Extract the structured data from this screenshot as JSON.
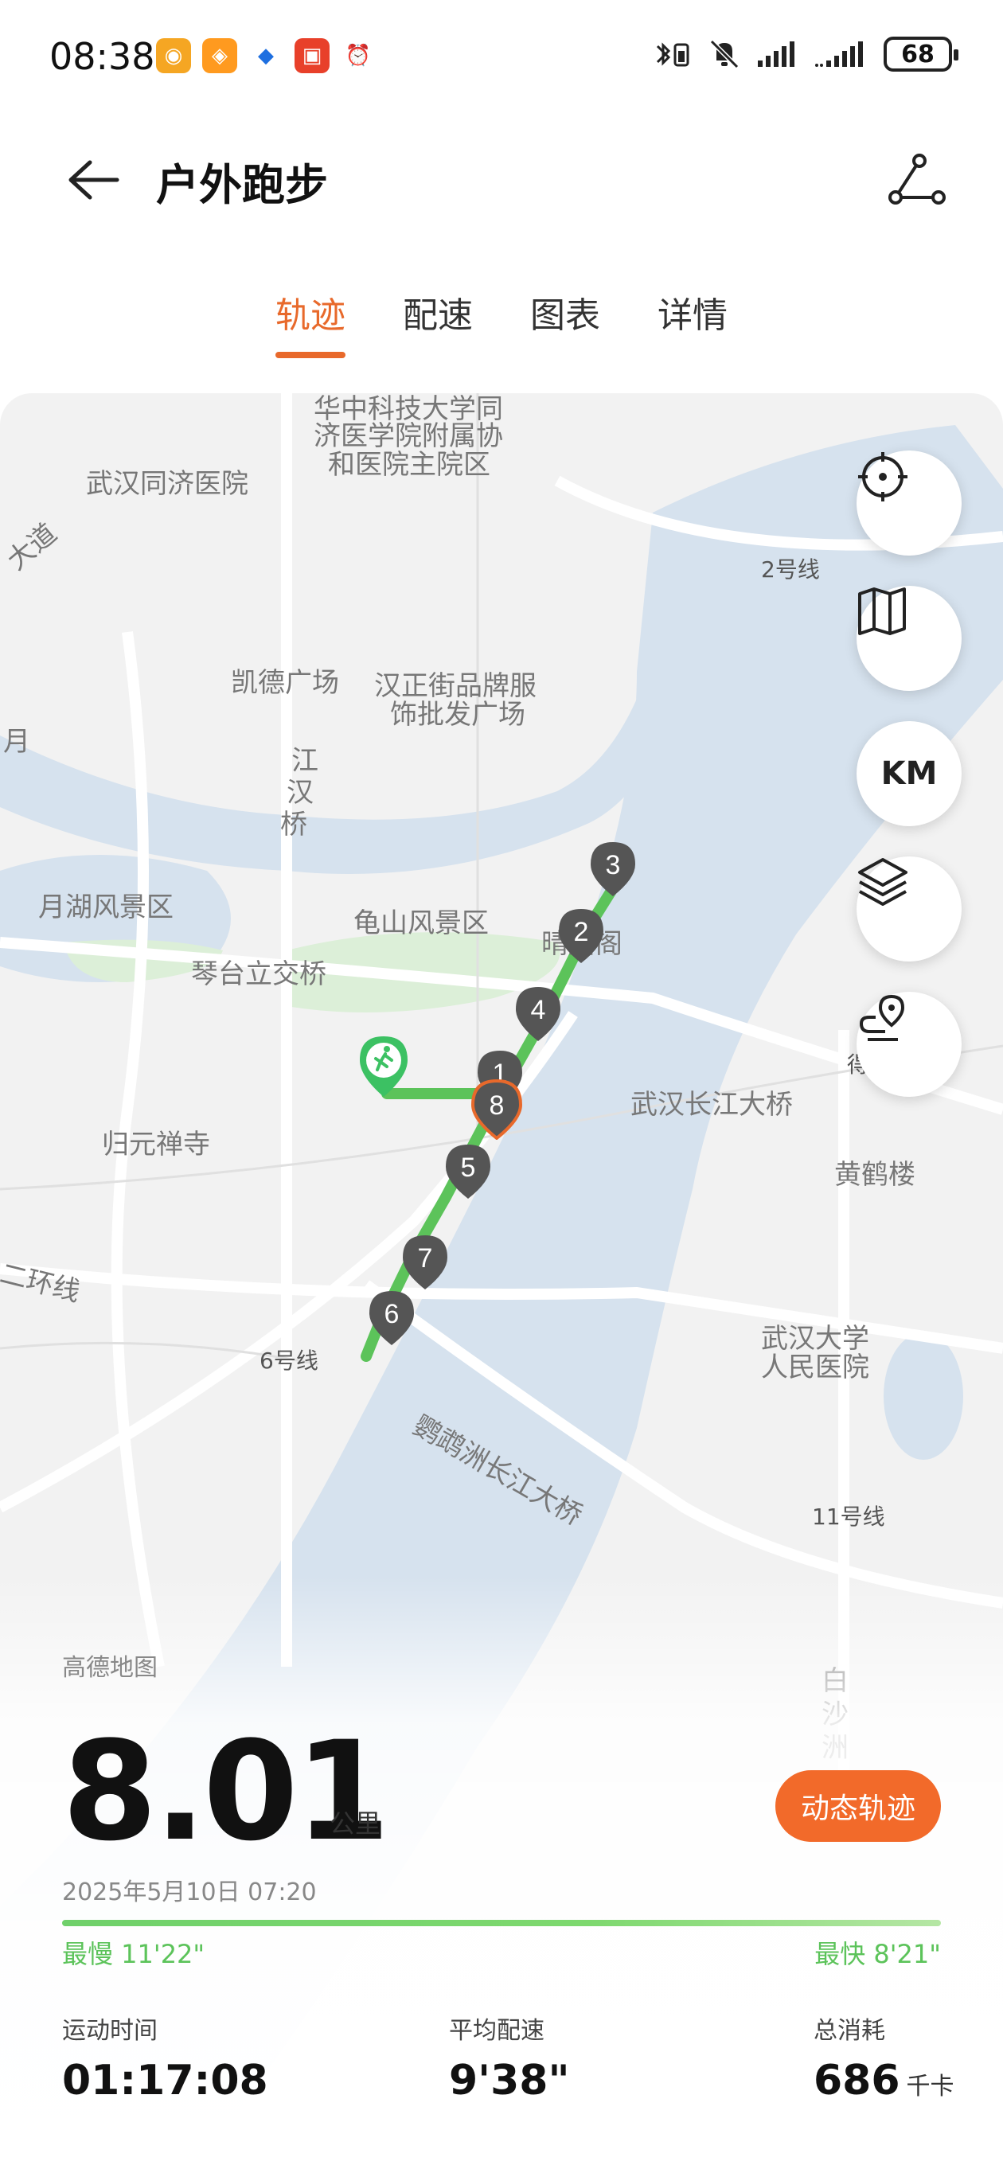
{
  "status_bar": {
    "time": "08:38",
    "battery": "68",
    "apps": [
      "weibo-icon",
      "app-orange-icon",
      "app-blue-icon",
      "app-red-icon",
      "alarm-icon"
    ]
  },
  "header": {
    "title": "户外跑步"
  },
  "tabs": [
    {
      "label": "轨迹",
      "active": true
    },
    {
      "label": "配速",
      "active": false
    },
    {
      "label": "图表",
      "active": false
    },
    {
      "label": "详情",
      "active": false
    }
  ],
  "map": {
    "labels": [
      "华中科技大学同",
      "济医学院附属协",
      "和医院主院区",
      "武汉同济医院",
      "大道",
      "2号线",
      "凯德广场",
      "汉正街品牌服",
      "饰批发广场",
      "江",
      "汉",
      "桥",
      "月",
      "月湖风景区",
      "龟山风景区",
      "晴川阁",
      "琴台立交桥",
      "武汉长江大桥",
      "得胜桥",
      "归元禅寺",
      "黄鹤楼",
      "二环线",
      "6号线",
      "鹦鹉洲长江大桥",
      "武汉大学",
      "人民医院",
      "11号线",
      "白",
      "沙",
      "洲"
    ],
    "markers": [
      "1",
      "2",
      "3",
      "4",
      "5",
      "6",
      "7",
      "8"
    ],
    "unit_toggle": "KM"
  },
  "summary": {
    "map_credit": "高德地图",
    "distance": "8.01",
    "distance_unit": "公里",
    "dynamic_button": "动态轨迹",
    "datetime": "2025年5月10日 07:20",
    "slowest": "最慢 11'22\"",
    "fastest": "最快 8'21\"",
    "stats": [
      {
        "label": "运动时间",
        "value": "01:17:08",
        "unit": ""
      },
      {
        "label": "平均配速",
        "value": "9'38\"",
        "unit": ""
      },
      {
        "label": "总消耗",
        "value": "686",
        "unit": "千卡"
      }
    ]
  },
  "colors": {
    "accent": "#e8692b",
    "button": "#f26a2a",
    "track": "#5cc35a",
    "river": "#d6e2ee"
  }
}
